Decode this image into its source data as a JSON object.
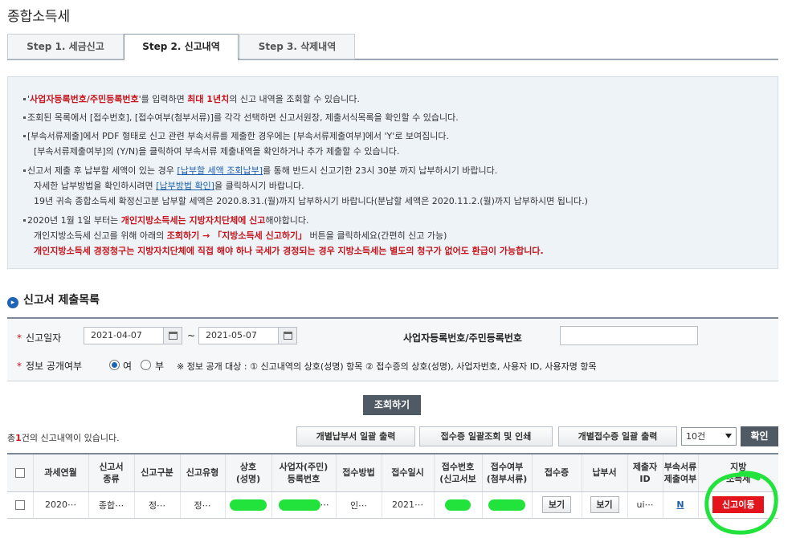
{
  "page": {
    "title": "종합소득세"
  },
  "tabs": [
    {
      "label": "Step 1. 세금신고"
    },
    {
      "label": "Step 2. 신고내역"
    },
    {
      "label": "Step 3. 삭제내역"
    }
  ],
  "info": {
    "l1a": "'",
    "l1b": "사업자등록번호/주민등록번호",
    "l1c": "'를 입력하면 ",
    "l1d": "최대 1년치",
    "l1e": "의 신고 내역을 조회할 수 있습니다.",
    "l2": "조회된 목록에서 [접수번호], [접수여부(첨부서류)]를 각각 선택하면 신고서원장, 제출서식목록을 확인할 수 있습니다.",
    "l3": "[부속서류제출]에서 PDF 형태로 신고 관련 부속서류를 제출한 경우에는 [부속서류제출여부]에서 'Y'로 보여집니다.",
    "l4": "[부속서류제출여부]의 (Y/N)을 클릭하여 부속서류 제출내역을 확인하거나 추가 제출할 수 있습니다.",
    "l5a": "신고서 제출 후 납부할 세액이 있는 경우 ",
    "l5b": "[납부할 세액 조회납부]",
    "l5c": "를 통해 반드시 신고기한 23시 30분 까지 납부하시기 바랍니다.",
    "l6a": "자세한 납부방법을 확인하시려면 ",
    "l6b": "[납부방법 확인]",
    "l6c": "을 클릭하시기 바랍니다.",
    "l7": "19년 귀속 종합소득세 확정신고분 납부할 세액은 2020.8.31.(월)까지 납부하시기 바랍니다(분납할 세액은 2020.11.2.(월)까지 납부하시면 됩니다.)",
    "l8a": "2020년 1월 1일 부터는 ",
    "l8b": "개인지방소득세는 지방자치단체에 신고",
    "l8c": "해야합니다.",
    "l9a": "개인지방소득세 신고를 위해 아래의 ",
    "l9b": "조회하기 → 「지방소득세 신고하기」",
    "l9c": " 버튼을 클릭하세요(간편히 신고 가능)",
    "l10": "개인지방소득세 경정청구는 지방자치단체에 직접 해야 하나 국세가 경정되는 경우 지방소득세는 별도의 청구가 없어도 환급이 가능합니다."
  },
  "section": {
    "title": "신고서 제출목록",
    "icon": "arrow-circle-icon"
  },
  "filter": {
    "date_label": "신고일자",
    "start_date": "2021-04-07",
    "tilde": "~",
    "end_date": "2021-05-07",
    "biz_label": "사업자등록번호/주민등록번호",
    "biz_value": "",
    "public_label": "정보 공개여부",
    "opt_yes": "여",
    "opt_no": "부",
    "public_note": "※ 정보 공개 대상 : ① 신고내역의 상호(성명) 항목 ② 접수증의 상호(성명), 사업자번호, 사용자 ID, 사용자명 항목"
  },
  "search_label": "조회하기",
  "results": {
    "count_prefix": "총",
    "count": "1",
    "count_suffix": "건의 신고내역이 있습니다.",
    "btn_batch_pay": "개별납부서 일괄 출력",
    "btn_batch_receipt": "접수증 일괄조회 및 인쇄",
    "btn_indiv_receipt": "개별접수증 일괄 출력",
    "page_size": "10건",
    "confirm_label": "확인"
  },
  "table": {
    "headers": [
      {
        "l1": "과세연월",
        "l2": ""
      },
      {
        "l1": "신고서",
        "l2": "종류"
      },
      {
        "l1": "신고구분",
        "l2": ""
      },
      {
        "l1": "신고유형",
        "l2": ""
      },
      {
        "l1": "상호",
        "l2": "(성명)"
      },
      {
        "l1": "사업자(주민)",
        "l2": "등록번호"
      },
      {
        "l1": "접수방법",
        "l2": ""
      },
      {
        "l1": "접수일시",
        "l2": ""
      },
      {
        "l1": "접수번호",
        "l2": "(신고서보"
      },
      {
        "l1": "접수여부",
        "l2": "(첨부서류)"
      },
      {
        "l1": "접수증",
        "l2": ""
      },
      {
        "l1": "납부서",
        "l2": ""
      },
      {
        "l1": "제출자",
        "l2": "ID"
      },
      {
        "l1": "부속서류",
        "l2": "제출여부"
      },
      {
        "l1": "지방",
        "l2": "소득세"
      }
    ],
    "row": {
      "period": "2020⋯",
      "kind": "종합⋯",
      "category": "정⋯",
      "type": "정⋯",
      "biz_suffix": "⋯",
      "method": "인⋯",
      "datetime": "2021⋯",
      "receipt_btn": "보기",
      "payment_btn": "보기",
      "submitter": "ui⋯",
      "attach": "N",
      "local_tax_btn": "신고이동"
    }
  }
}
